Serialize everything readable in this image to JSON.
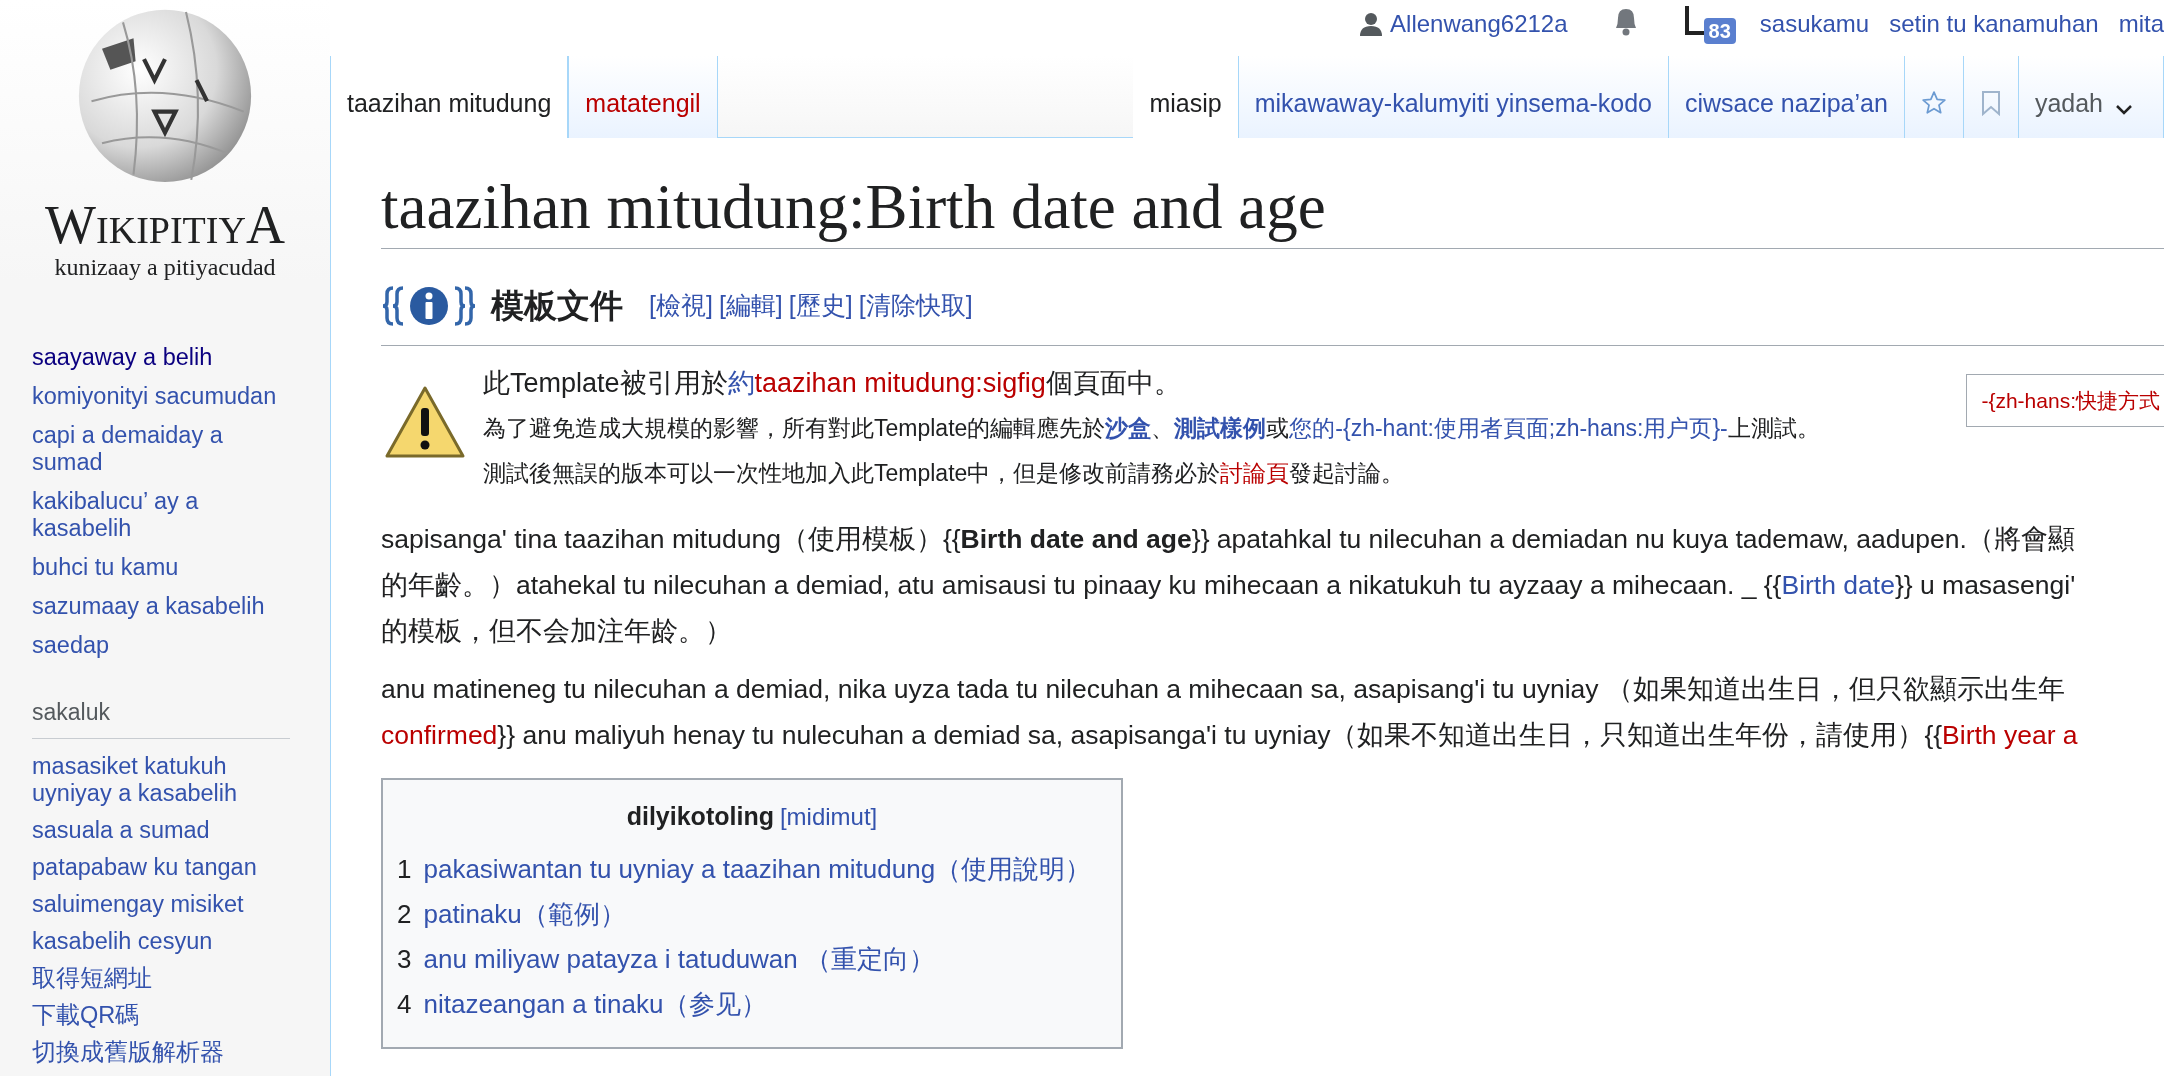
{
  "logo": {
    "wordmark": "WikipitiyA",
    "tagline": "kunizaay a pitiyacudad"
  },
  "user_bar": [
    {
      "kind": "user",
      "label": "Allenwang6212a"
    },
    {
      "kind": "bell"
    },
    {
      "kind": "notices",
      "badge": "83"
    },
    {
      "kind": "link",
      "label": "sasukamu"
    },
    {
      "kind": "link",
      "label": "setin tu kanamuhan"
    },
    {
      "kind": "link",
      "label": "mita"
    }
  ],
  "left_tabs": [
    {
      "label": "taazihan mitudung",
      "selected": true,
      "exists": true
    },
    {
      "label": "matatengil",
      "selected": false,
      "exists": false
    }
  ],
  "right_tabs": [
    {
      "kind": "tab",
      "label": "miasip",
      "selected": true
    },
    {
      "kind": "tab",
      "label": "mikawaway-kalumyiti yinsema-kodo",
      "selected": false
    },
    {
      "kind": "tab",
      "label": "ciwsace nazipa’an",
      "selected": false
    },
    {
      "kind": "star"
    },
    {
      "kind": "bookmark"
    },
    {
      "kind": "menu",
      "label": "yadah"
    }
  ],
  "sidebar": {
    "navigation": [
      {
        "label": "saayaway a belih",
        "visited": true
      },
      {
        "label": "komiyonityi sacumudan",
        "visited": false
      },
      {
        "label": "capi a demaiday a sumad",
        "visited": false
      },
      {
        "label": "kakibalucu’ ay a kasabelih",
        "visited": false
      },
      {
        "label": "buhci tu kamu",
        "visited": false
      },
      {
        "label": "sazumaay a kasabelih",
        "visited": false
      },
      {
        "label": "saedap",
        "visited": false
      }
    ],
    "tools_heading": "sakaluk",
    "tools": [
      "masasiket katukuh uyniyay a kasabelih",
      "sasuala a sumad",
      "patapabaw ku tangan",
      "saluimengay misiket",
      "kasabelih cesyun",
      "取得短網址",
      "下載QR碼",
      "切換成舊版解析器"
    ]
  },
  "title": "taazihan mitudung:Birth date and age",
  "doc_header": {
    "title": "模板文件",
    "links": [
      "[檢視]",
      "[編輯]",
      "[歷史]",
      "[清除快取]"
    ]
  },
  "notice": {
    "lines": [
      [
        {
          "kind": "text",
          "text": "此Template被引用於"
        },
        {
          "kind": "link",
          "text": "約"
        },
        {
          "kind": "redlink",
          "text": "taazihan mitudung:sigfig"
        },
        {
          "kind": "text",
          "text": "個頁面中。"
        }
      ],
      [
        {
          "kind": "text",
          "text": "為了避免造成大規模的影響，所有對此Template的編輯應先於"
        },
        {
          "kind": "boldlink",
          "text": "沙盒"
        },
        {
          "kind": "text",
          "text": "、"
        },
        {
          "kind": "boldlink",
          "text": "測試樣例"
        },
        {
          "kind": "text",
          "text": "或"
        },
        {
          "kind": "link",
          "text": "您的-{zh-hant:使用者頁面;zh-hans:用户页}-"
        },
        {
          "kind": "text",
          "text": "上測試。"
        }
      ],
      [
        {
          "kind": "text",
          "text": "測試後無誤的版本可以一次性地加入此Template中，但是修改前請務必於"
        },
        {
          "kind": "redlink",
          "text": "討論頁"
        },
        {
          "kind": "text",
          "text": "發起討論。"
        }
      ]
    ],
    "side_box": "-{zh-hans:快捷方式"
  },
  "paragraphs": [
    [
      [
        {
          "kind": "text",
          "text": "sapisanga' tina taazihan mitudung（使用模板）{{"
        },
        {
          "kind": "bold",
          "text": "Birth date and age"
        },
        {
          "kind": "text",
          "text": "}} apatahkal tu nilecuhan a demiadan nu kuya tademaw, aadupen.（將會顯"
        }
      ],
      [
        {
          "kind": "text",
          "text": "的年齡。）atahekal tu nilecuhan a demiad, atu amisausi tu pinaay ku mihecaan a nikatukuh tu ayzaay a mihecaan. _ {{"
        },
        {
          "kind": "link",
          "text": "Birth date"
        },
        {
          "kind": "text",
          "text": "}} u masasengi'"
        }
      ],
      [
        {
          "kind": "text",
          "text": "的模板，但不会加注年龄。）"
        }
      ]
    ],
    [
      [
        {
          "kind": "text",
          "text": "anu matineneg tu nilecuhan a demiad, nika uyza tada tu nilecuhan a mihecaan sa, asapisang'i tu uyniay （如果知道出生日，但只欲顯示出生年"
        }
      ],
      [
        {
          "kind": "redlink",
          "text": "confirmed"
        },
        {
          "kind": "text",
          "text": "}} anu maliyuh henay tu nulecuhan a demiad sa, asapisanga'i tu uyniay（如果不知道出生日，只知道出生年份，請使用）{{"
        },
        {
          "kind": "redlink",
          "text": "Birth year a"
        }
      ]
    ]
  ],
  "toc": {
    "title": "dilyikotoling",
    "toggle": "[midimut]",
    "items": [
      {
        "number": "1",
        "label": "pakasiwantan tu uyniay a taazihan mitudung（使用說明）"
      },
      {
        "number": "2",
        "label": "patinaku（範例）"
      },
      {
        "number": "3",
        "label": "anu miliyaw patayza i tatuduwan （重定向）"
      },
      {
        "number": "4",
        "label": "nitazeangan a tinaku（参见）"
      }
    ]
  }
}
